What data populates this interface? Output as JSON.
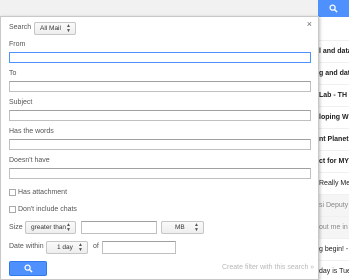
{
  "background": {
    "list_rows": [
      {
        "text": "l and data",
        "style": "bold"
      },
      {
        "text": "g and dat",
        "style": "bold"
      },
      {
        "text": "Lab - TH",
        "style": "bold"
      },
      {
        "text": "loping W",
        "style": "bold"
      },
      {
        "text": "nt Planet",
        "style": "bold"
      },
      {
        "text": "ct for MY",
        "style": "bold"
      },
      {
        "text": "Really Me",
        "style": "normal"
      },
      {
        "text": "si Deputy",
        "style": "gray"
      },
      {
        "text": "out me in",
        "style": "gray"
      },
      {
        "text": "g begin! -",
        "style": "normal"
      },
      {
        "text": "day is Tue",
        "style": "normal"
      }
    ]
  },
  "dialog": {
    "close_glyph": "×",
    "search_label": "Search",
    "search_scope": "All Mail",
    "from_label": "From",
    "to_label": "To",
    "subject_label": "Subject",
    "has_words_label": "Has the words",
    "doesnt_have_label": "Doesn't have",
    "has_attachment_label": "Has attachment",
    "dont_include_chats_label": "Don't include chats",
    "size_label": "Size",
    "size_operator": "greater than",
    "size_unit": "MB",
    "date_within_label": "Date within",
    "date_within_value": "1 day",
    "of_label": "of",
    "create_filter_label": "Create filter with this search »"
  },
  "colors": {
    "accent": "#4d90fe",
    "border": "#c0c0c0"
  }
}
